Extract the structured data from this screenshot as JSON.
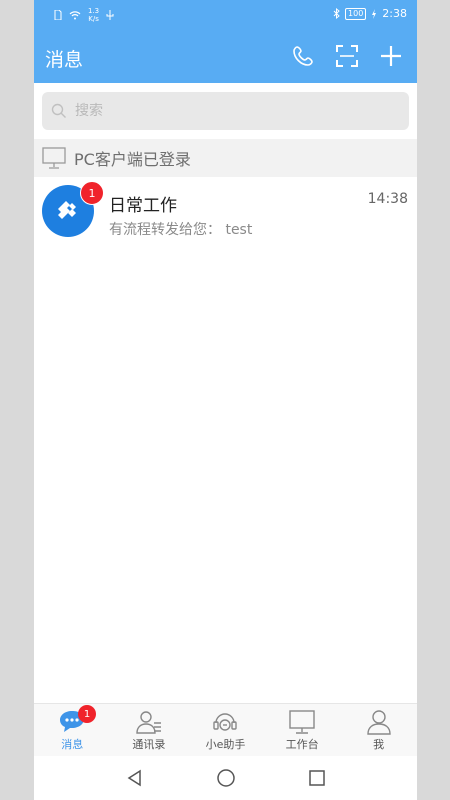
{
  "status_bar": {
    "speed_value": "1.3",
    "speed_unit": "K/s",
    "battery": "100",
    "time": "2:38"
  },
  "header": {
    "title": "消息",
    "icons": [
      "phone-icon",
      "scan-icon",
      "add-icon"
    ]
  },
  "search": {
    "placeholder": "搜索"
  },
  "pc_banner": {
    "text": "PC客户端已登录"
  },
  "messages": [
    {
      "name": "日常工作",
      "preview": "有流程转发给您： test",
      "time": "14:38",
      "badge": "1",
      "avatar_color": "#1e7fe0"
    }
  ],
  "tabs": [
    {
      "label": "消息",
      "icon": "chat-icon",
      "badge": "1",
      "active": true
    },
    {
      "label": "通讯录",
      "icon": "contacts-icon"
    },
    {
      "label": "小e助手",
      "icon": "assistant-icon"
    },
    {
      "label": "工作台",
      "icon": "workbench-icon"
    },
    {
      "label": "我",
      "icon": "profile-icon"
    }
  ],
  "colors": {
    "accent": "#58acf3",
    "active_tab": "#3e94e8",
    "badge": "#f0232b"
  }
}
